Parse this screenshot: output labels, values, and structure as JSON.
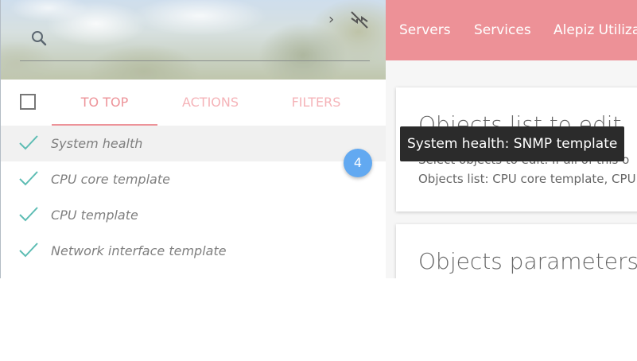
{
  "sidebar": {
    "search_icon": "search-icon",
    "chevron_icon": "chevron-right-icon",
    "collapse_icon": "collapse-arrows-icon",
    "tabs": [
      "TO TOP",
      "ACTIONS",
      "FILTERS"
    ],
    "items": [
      {
        "label": "System health",
        "checked": true
      },
      {
        "label": "CPU core template",
        "checked": true
      },
      {
        "label": "CPU template",
        "checked": true
      },
      {
        "label": "Network interface template",
        "checked": true
      }
    ],
    "badge": "4"
  },
  "topnav": {
    "links": [
      "Servers",
      "Services",
      "Alepiz Utilizat"
    ]
  },
  "main": {
    "card1": {
      "title": "Objects list to edit",
      "text1": "Select objects to edit. If all of this o",
      "text2": "Objects list: CPU core template, CPU t"
    },
    "card2": {
      "title": "Objects parameters"
    }
  },
  "tooltip": {
    "text": "System health: SNMP template"
  },
  "colors": {
    "accent": "#e76d75",
    "badge": "#2e8ded",
    "check": "#26a69a"
  }
}
